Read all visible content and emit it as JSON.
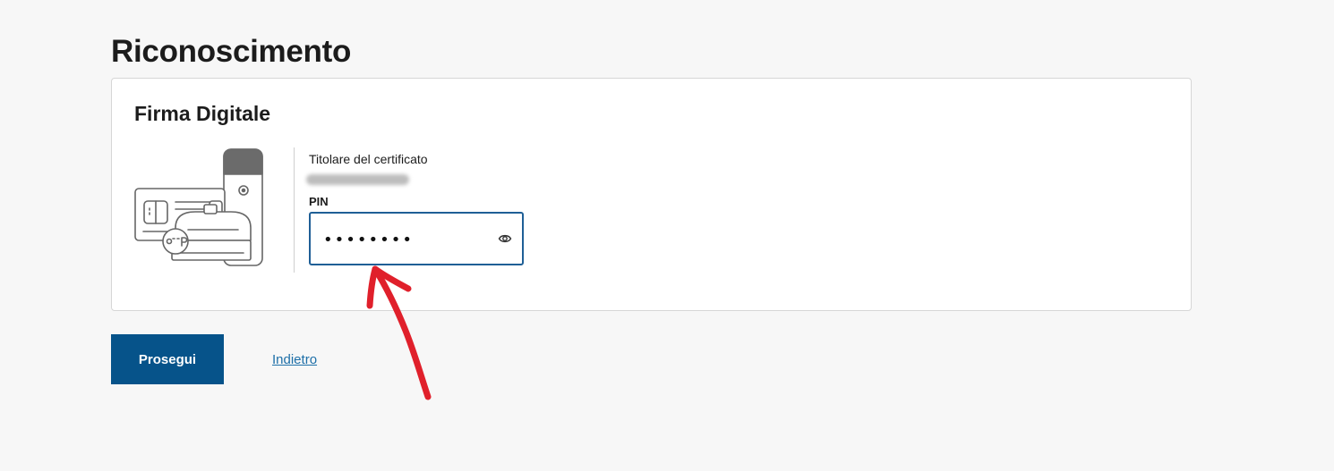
{
  "page": {
    "title": "Riconoscimento"
  },
  "card": {
    "title": "Firma Digitale",
    "illustration_icon": "digital-signature-devices-icon",
    "certificate": {
      "label": "Titolare del certificato",
      "holder_name": ""
    },
    "pin": {
      "label": "PIN",
      "value": "••••••••",
      "masked": true,
      "toggle_icon": "eye-icon"
    }
  },
  "actions": {
    "proceed_label": "Prosegui",
    "back_label": "Indietro"
  },
  "colors": {
    "background": "#f7f7f7",
    "primary": "#06538a",
    "link": "#1d6fa8",
    "focus_border": "#1f5f96",
    "annotation_arrow": "#e0202b"
  }
}
